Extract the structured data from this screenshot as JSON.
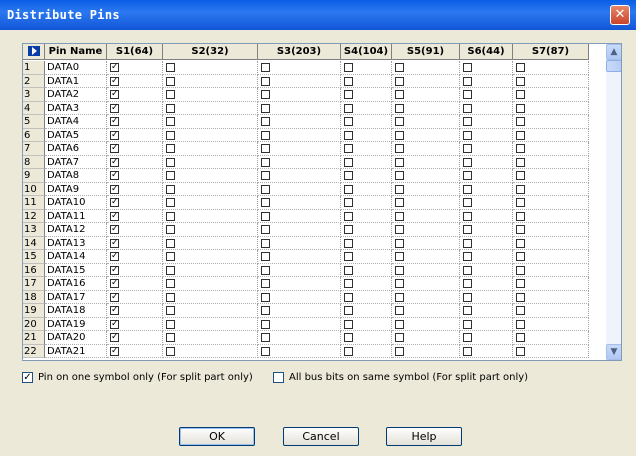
{
  "window": {
    "title": "Distribute Pins",
    "close_glyph": "✕"
  },
  "grid": {
    "corner_icon": "row-select-arrow-icon",
    "columns": [
      "Pin Name",
      "S1(64)",
      "S2(32)",
      "S3(203)",
      "S4(104)",
      "S5(91)",
      "S6(44)",
      "S7(87)"
    ],
    "rows": [
      {
        "num": "1",
        "pin": "DATA0",
        "checks": [
          true,
          false,
          false,
          false,
          false,
          false,
          false
        ]
      },
      {
        "num": "2",
        "pin": "DATA1",
        "checks": [
          true,
          false,
          false,
          false,
          false,
          false,
          false
        ]
      },
      {
        "num": "3",
        "pin": "DATA2",
        "checks": [
          true,
          false,
          false,
          false,
          false,
          false,
          false
        ]
      },
      {
        "num": "4",
        "pin": "DATA3",
        "checks": [
          true,
          false,
          false,
          false,
          false,
          false,
          false
        ]
      },
      {
        "num": "5",
        "pin": "DATA4",
        "checks": [
          true,
          false,
          false,
          false,
          false,
          false,
          false
        ]
      },
      {
        "num": "6",
        "pin": "DATA5",
        "checks": [
          true,
          false,
          false,
          false,
          false,
          false,
          false
        ]
      },
      {
        "num": "7",
        "pin": "DATA6",
        "checks": [
          true,
          false,
          false,
          false,
          false,
          false,
          false
        ]
      },
      {
        "num": "8",
        "pin": "DATA7",
        "checks": [
          true,
          false,
          false,
          false,
          false,
          false,
          false
        ]
      },
      {
        "num": "9",
        "pin": "DATA8",
        "checks": [
          true,
          false,
          false,
          false,
          false,
          false,
          false
        ]
      },
      {
        "num": "10",
        "pin": "DATA9",
        "checks": [
          true,
          false,
          false,
          false,
          false,
          false,
          false
        ]
      },
      {
        "num": "11",
        "pin": "DATA10",
        "checks": [
          true,
          false,
          false,
          false,
          false,
          false,
          false
        ]
      },
      {
        "num": "12",
        "pin": "DATA11",
        "checks": [
          true,
          false,
          false,
          false,
          false,
          false,
          false
        ]
      },
      {
        "num": "13",
        "pin": "DATA12",
        "checks": [
          true,
          false,
          false,
          false,
          false,
          false,
          false
        ]
      },
      {
        "num": "14",
        "pin": "DATA13",
        "checks": [
          true,
          false,
          false,
          false,
          false,
          false,
          false
        ]
      },
      {
        "num": "15",
        "pin": "DATA14",
        "checks": [
          true,
          false,
          false,
          false,
          false,
          false,
          false
        ]
      },
      {
        "num": "16",
        "pin": "DATA15",
        "checks": [
          true,
          false,
          false,
          false,
          false,
          false,
          false
        ]
      },
      {
        "num": "17",
        "pin": "DATA16",
        "checks": [
          true,
          false,
          false,
          false,
          false,
          false,
          false
        ]
      },
      {
        "num": "18",
        "pin": "DATA17",
        "checks": [
          true,
          false,
          false,
          false,
          false,
          false,
          false
        ]
      },
      {
        "num": "19",
        "pin": "DATA18",
        "checks": [
          true,
          false,
          false,
          false,
          false,
          false,
          false
        ]
      },
      {
        "num": "20",
        "pin": "DATA19",
        "checks": [
          true,
          false,
          false,
          false,
          false,
          false,
          false
        ]
      },
      {
        "num": "21",
        "pin": "DATA20",
        "checks": [
          true,
          false,
          false,
          false,
          false,
          false,
          false
        ]
      },
      {
        "num": "22",
        "pin": "DATA21",
        "checks": [
          true,
          false,
          false,
          false,
          false,
          false,
          false
        ]
      }
    ],
    "check_glyph": "✓"
  },
  "scrollbar": {
    "up_glyph": "▲",
    "down_glyph": "▼"
  },
  "options": {
    "pin_on_one_symbol": {
      "label": "Pin on one symbol only (For split part only)",
      "checked": true
    },
    "all_bus_bits": {
      "label": "All bus bits on same symbol (For split part only)",
      "checked": false
    }
  },
  "buttons": {
    "ok": "OK",
    "cancel": "Cancel",
    "help": "Help"
  },
  "colors": {
    "title_bar": "#0a5ee6",
    "dialog_bg": "#ece9d8",
    "grid_border": "#7f9db9"
  }
}
